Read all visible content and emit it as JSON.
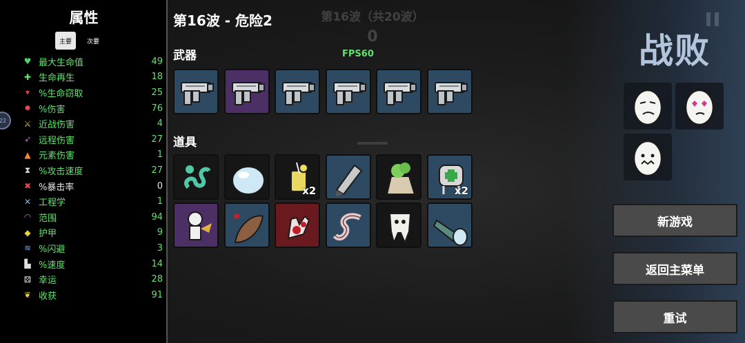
{
  "stats_panel": {
    "title": "属性",
    "tab_primary": "主要",
    "tab_secondary": "次要",
    "badge": "22",
    "items": [
      {
        "label": "最大生命值",
        "value": "49",
        "icon": "heart-icon",
        "glyph": "♥",
        "color": "#4fd36a"
      },
      {
        "label": "生命再生",
        "value": "18",
        "icon": "regen-icon",
        "glyph": "✚",
        "color": "#5fe36a"
      },
      {
        "label": "%生命窃取",
        "value": "25",
        "icon": "fangs-icon",
        "glyph": "▾",
        "color": "#d24a4a"
      },
      {
        "label": "%伤害",
        "value": "76",
        "icon": "muscle-icon",
        "glyph": "✹",
        "color": "#e0505a"
      },
      {
        "label": "近战伤害",
        "value": "4",
        "icon": "sword-icon",
        "glyph": "⚔",
        "color": "#d8c05a"
      },
      {
        "label": "远程伤害",
        "value": "27",
        "icon": "bow-icon",
        "glyph": "➶",
        "color": "#c070d8"
      },
      {
        "label": "元素伤害",
        "value": "1",
        "icon": "flame-icon",
        "glyph": "▲",
        "color": "#f08a3a"
      },
      {
        "label": "%攻击速度",
        "value": "27",
        "icon": "hourglass-icon",
        "glyph": "⧗",
        "color": "#dddddd"
      },
      {
        "label": "%暴击率",
        "value": "0",
        "icon": "crit-icon",
        "glyph": "✖",
        "color": "#e04848"
      },
      {
        "label": "工程学",
        "value": "1",
        "icon": "wrench-icon",
        "glyph": "✕",
        "color": "#8ab4e8"
      },
      {
        "label": "范围",
        "value": "94",
        "icon": "range-icon",
        "glyph": "◠",
        "color": "#c070d8"
      },
      {
        "label": "护甲",
        "value": "9",
        "icon": "shield-icon",
        "glyph": "◆",
        "color": "#e8d040"
      },
      {
        "label": "%闪避",
        "value": "3",
        "icon": "dodge-icon",
        "glyph": "≋",
        "color": "#6fa8e8"
      },
      {
        "label": "%速度",
        "value": "14",
        "icon": "boot-icon",
        "glyph": "▙",
        "color": "#e0e0e0"
      },
      {
        "label": "幸运",
        "value": "28",
        "icon": "dice-icon",
        "glyph": "⚄",
        "color": "#e8e8e8"
      },
      {
        "label": "收获",
        "value": "91",
        "icon": "harvest-icon",
        "glyph": "❦",
        "color": "#e8d040"
      }
    ],
    "white_rows": [
      8
    ]
  },
  "header": {
    "wave_title": "第16波 - 危险2",
    "bg_wave": "第16波（共20波）",
    "bg_count": "0",
    "fps": "FPS60"
  },
  "weapons": {
    "label": "武器",
    "slots": [
      {
        "name": "pistol",
        "tier": "blue"
      },
      {
        "name": "pistol",
        "tier": "purple"
      },
      {
        "name": "pistol",
        "tier": "blue"
      },
      {
        "name": "pistol",
        "tier": "blue"
      },
      {
        "name": "pistol",
        "tier": "blue"
      },
      {
        "name": "pistol",
        "tier": "blue"
      }
    ]
  },
  "items": {
    "label": "道具",
    "slots": [
      {
        "name": "alien-tentacle-icon",
        "tier": "dark",
        "qty": ""
      },
      {
        "name": "jelly-blob-icon",
        "tier": "dark",
        "qty": ""
      },
      {
        "name": "lemonade-icon",
        "tier": "dark",
        "qty": "x2"
      },
      {
        "name": "rocket-icon",
        "tier": "blue",
        "qty": ""
      },
      {
        "name": "fertilizer-sack-icon",
        "tier": "dark",
        "qty": ""
      },
      {
        "name": "medkit-backpack-icon",
        "tier": "blue",
        "qty": "x2"
      },
      {
        "name": "voodoo-doll-icon",
        "tier": "purple",
        "qty": ""
      },
      {
        "name": "leech-icon",
        "tier": "blue",
        "qty": ""
      },
      {
        "name": "bloody-hand-icon",
        "tier": "red",
        "qty": ""
      },
      {
        "name": "worm-icon",
        "tier": "blue",
        "qty": ""
      },
      {
        "name": "tooth-icon",
        "tier": "dark",
        "qty": ""
      },
      {
        "name": "flashlight-icon",
        "tier": "blue",
        "qty": ""
      }
    ]
  },
  "result": {
    "title": "战败",
    "characters": [
      "sad-egg-icon",
      "lovestruck-egg-icon",
      "sick-egg-icon"
    ]
  },
  "buttons": {
    "new_game": "新游戏",
    "main_menu": "返回主菜单",
    "retry": "重试"
  }
}
